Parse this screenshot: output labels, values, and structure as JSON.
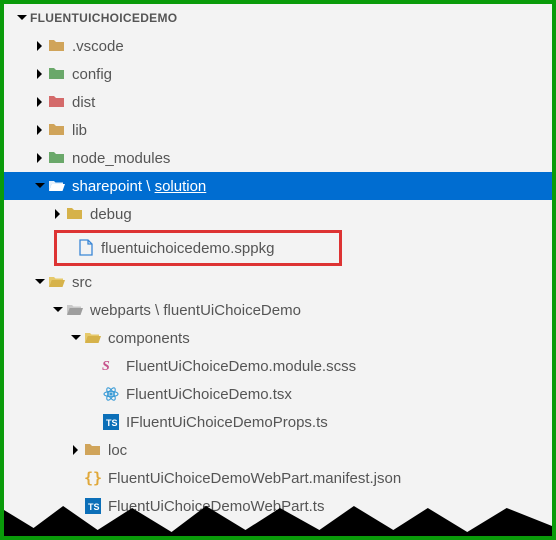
{
  "header": {
    "title": "FLUENTUICHOICEDEMO"
  },
  "tree": {
    "vscode": ".vscode",
    "config": "config",
    "dist": "dist",
    "lib": "lib",
    "node_modules": "node_modules",
    "sharepoint_prefix": "sharepoint \\ ",
    "sharepoint_solution": "solution",
    "debug": "debug",
    "sppkg": "fluentuichoicedemo.sppkg",
    "src": "src",
    "webparts_prefix": "webparts \\ ",
    "webparts_suffix": "fluentUiChoiceDemo",
    "components": "components",
    "scss": "FluentUiChoiceDemo.module.scss",
    "tsx": "FluentUiChoiceDemo.tsx",
    "props": "IFluentUiChoiceDemoProps.ts",
    "loc": "loc",
    "manifest": "FluentUiChoiceDemoWebPart.manifest.json",
    "webpart_ts": "FluentUiChoiceDemoWebPart.ts"
  },
  "colors": {
    "selected_bg": "#006dd1",
    "highlight_border": "#d33",
    "outer_border": "#0a9b0a"
  }
}
